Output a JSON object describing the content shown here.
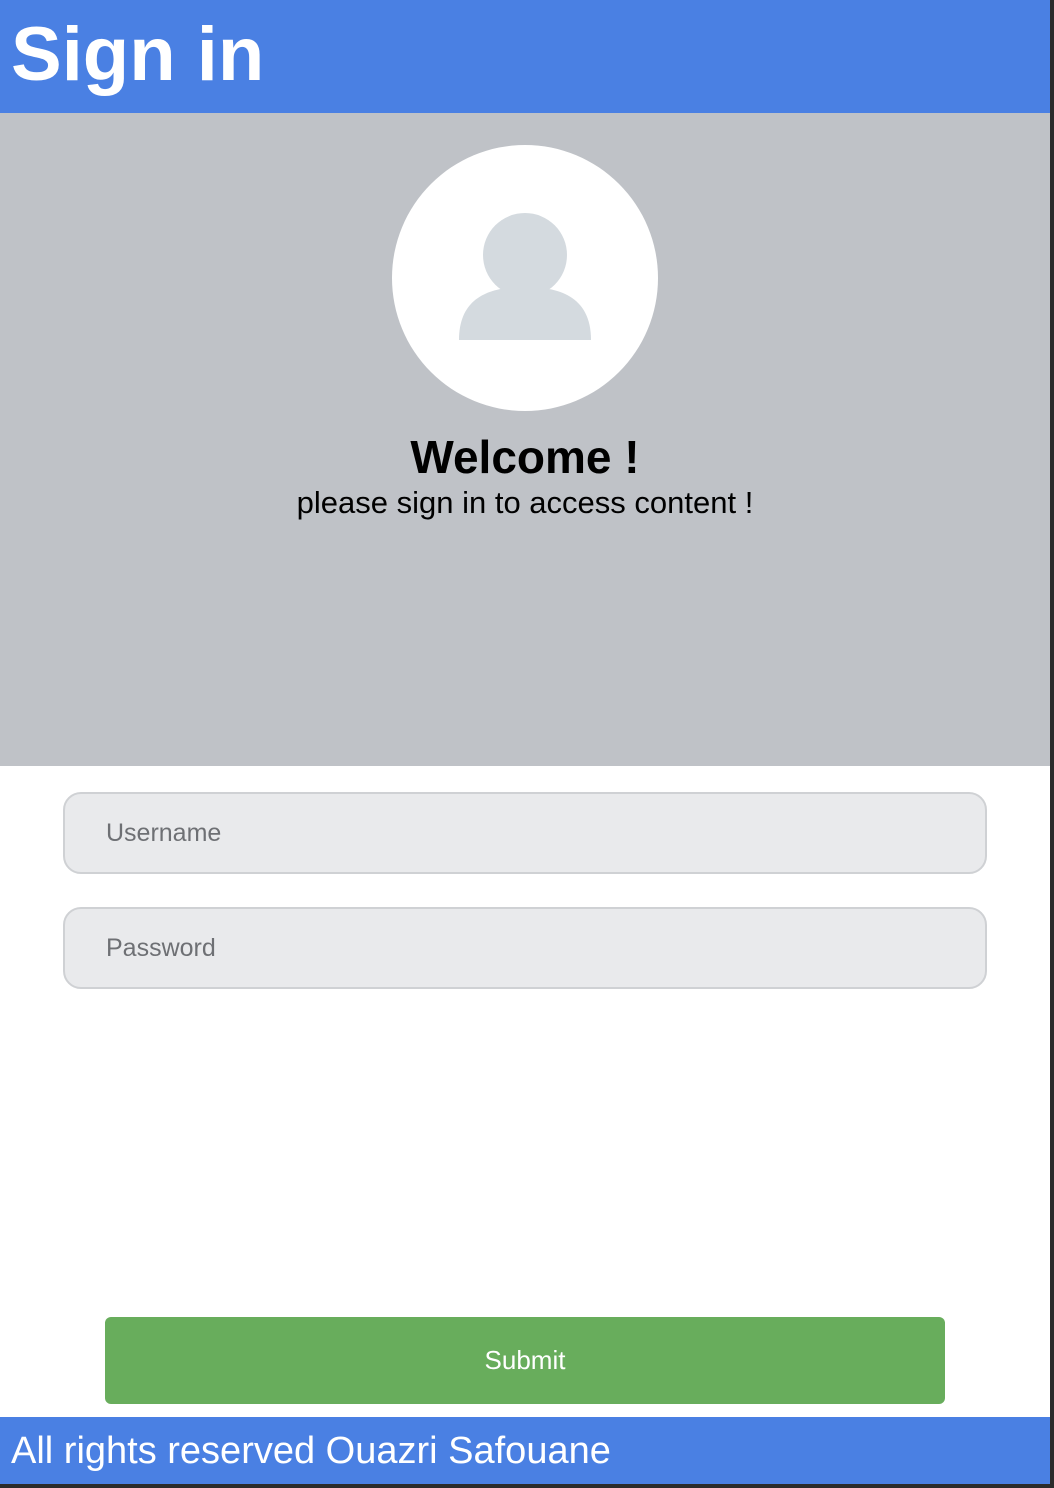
{
  "header": {
    "title": "Sign in"
  },
  "welcome": {
    "title": "Welcome !",
    "subtitle": "please sign in to access content !"
  },
  "avatar": {
    "icon": "user-placeholder-icon"
  },
  "form": {
    "username": {
      "value": "",
      "placeholder": "Username"
    },
    "password": {
      "value": "",
      "placeholder": "Password"
    },
    "submit_label": "Submit"
  },
  "footer": {
    "text": "All rights reserved Ouazri Safouane"
  },
  "colors": {
    "header_bg": "#4a80e3",
    "hero_bg": "#bfc2c7",
    "input_bg": "#e9eaec",
    "submit_bg": "#68ad5c",
    "avatar_icon": "#d4dadf"
  }
}
